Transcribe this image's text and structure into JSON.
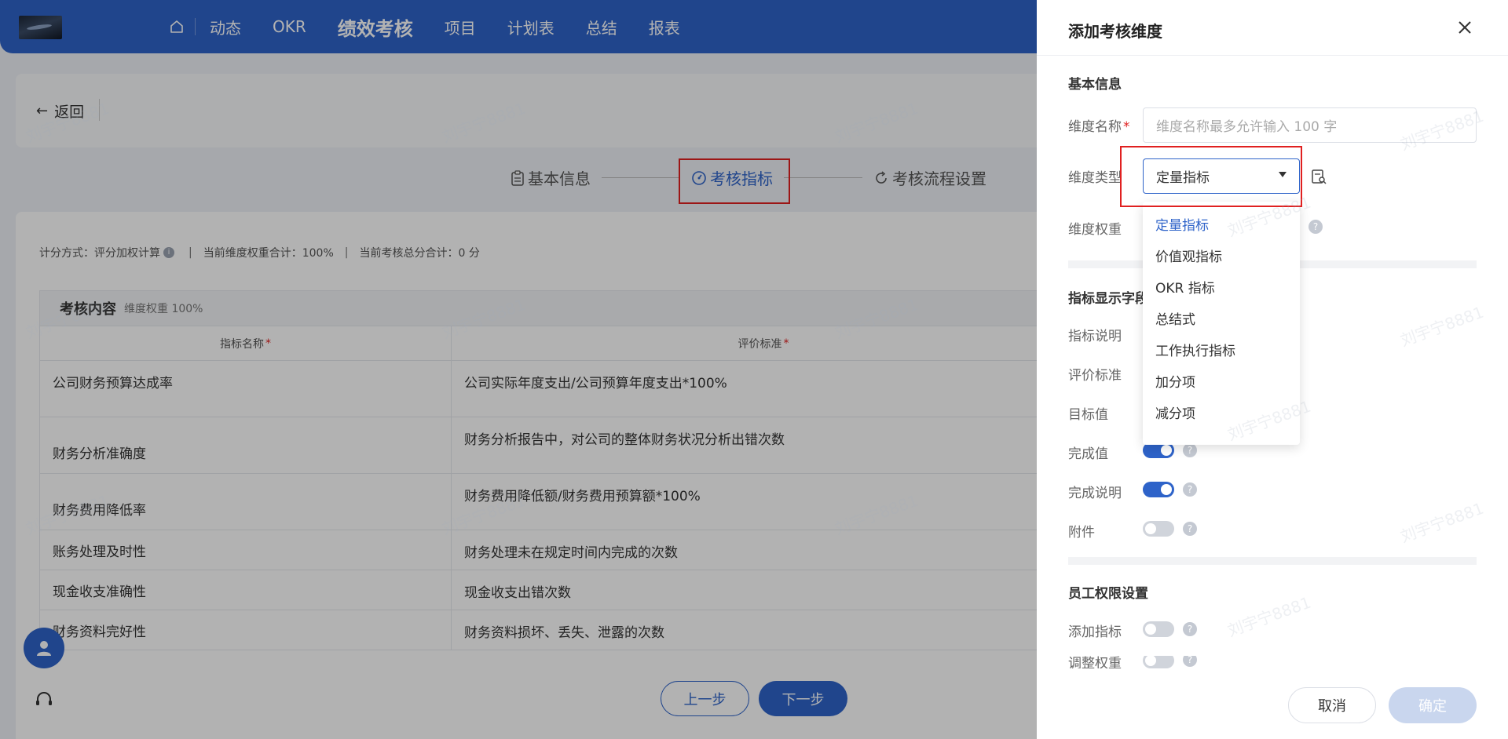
{
  "nav": {
    "items": [
      {
        "label": "动态",
        "active": false
      },
      {
        "label": "OKR",
        "active": false
      },
      {
        "label": "绩效考核",
        "active": true
      },
      {
        "label": "项目",
        "active": false
      },
      {
        "label": "计划表",
        "active": false
      },
      {
        "label": "总结",
        "active": false
      },
      {
        "label": "报表",
        "active": false
      }
    ]
  },
  "back_label": "返回",
  "steps": [
    {
      "label": "基本信息",
      "icon": "clipboard-icon",
      "active": false
    },
    {
      "label": "考核指标",
      "icon": "gauge-icon",
      "active": true
    },
    {
      "label": "考核流程设置",
      "icon": "refresh-icon",
      "active": false
    }
  ],
  "summary": {
    "method": "计分方式：评分加权计算",
    "weight_total": "当前维度权重合计：100%",
    "score_total": "当前考核总分合计：0 分"
  },
  "table": {
    "section_title": "考核内容",
    "section_weight": "维度权重 100%",
    "col_name": "指标名称",
    "col_criteria": "评价标准",
    "required_mark": "*",
    "rows": [
      {
        "name": "公司财务预算达成率",
        "criteria": "公司实际年度支出/公司预算年度支出*100%"
      },
      {
        "name": "财务分析准确度",
        "criteria": "财务分析报告中，对公司的整体财务状况分析出错次数"
      },
      {
        "name": "财务费用降低率",
        "criteria": "财务费用降低额/财务费用预算额*100%"
      },
      {
        "name": "账务处理及时性",
        "criteria": "财务处理未在规定时间内完成的次数"
      },
      {
        "name": "现金收支准确性",
        "criteria": "现金收支出错次数"
      },
      {
        "name": "财务资料完好性",
        "criteria": "财务资料损坏、丢失、泄露的次数"
      }
    ]
  },
  "buttons": {
    "prev": "上一步",
    "next": "下一步"
  },
  "drawer": {
    "title": "添加考核维度",
    "basic_section": "基本信息",
    "name_label": "维度名称",
    "name_placeholder": "维度名称最多允许输入 100 字",
    "type_label": "维度类型",
    "type_value": "定量指标",
    "weight_label": "维度权重",
    "display_section": "指标显示字段",
    "fields": [
      {
        "label": "指标说明",
        "on": null
      },
      {
        "label": "评价标准",
        "on": null
      },
      {
        "label": "目标值",
        "on": null
      },
      {
        "label": "完成值",
        "on": true
      },
      {
        "label": "完成说明",
        "on": true
      },
      {
        "label": "附件",
        "on": false
      }
    ],
    "perm_section": "员工权限设置",
    "perms": [
      {
        "label": "添加指标",
        "on": false
      },
      {
        "label": "调整权重",
        "on": false
      }
    ],
    "cancel": "取消",
    "ok": "确定"
  },
  "dropdown": {
    "options": [
      "定量指标",
      "价值观指标",
      "OKR 指标",
      "总结式",
      "工作执行指标",
      "加分项",
      "减分项"
    ],
    "selected": "定量指标"
  },
  "watermark": "刘宇宁8881",
  "colors": {
    "primary": "#2e63c9",
    "highlight": "#e02020"
  }
}
